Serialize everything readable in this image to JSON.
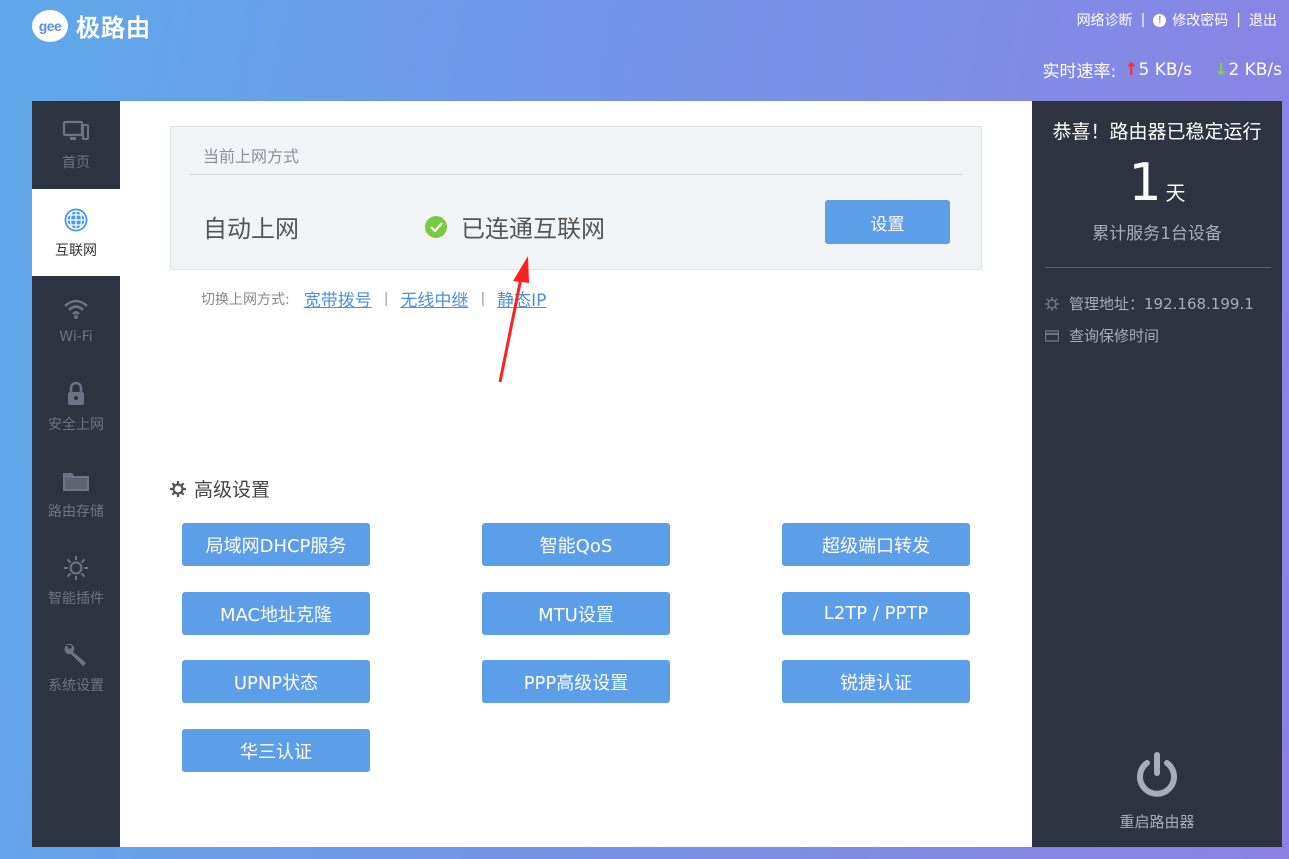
{
  "header": {
    "logo_badge": "gee",
    "title": "极路由",
    "links": {
      "diagnose": "网络诊断",
      "change_password": "修改密码",
      "logout": "退出"
    },
    "sep": "|",
    "speed_label": "实时速率:",
    "upload": "5 KB/s",
    "download": "2 KB/s",
    "up_arrow": "↑",
    "down_arrow": "↓",
    "info_icon_text": "!"
  },
  "sidebar": {
    "items": [
      {
        "label": "首页",
        "icon": "monitor-icon"
      },
      {
        "label": "互联网",
        "icon": "globe-icon",
        "active": true
      },
      {
        "label": "Wi-Fi",
        "icon": "wifi-icon"
      },
      {
        "label": "安全上网",
        "icon": "lock-icon"
      },
      {
        "label": "路由存储",
        "icon": "folder-icon"
      },
      {
        "label": "智能插件",
        "icon": "bulb-icon"
      },
      {
        "label": "系统设置",
        "icon": "wrench-icon"
      }
    ]
  },
  "main": {
    "card": {
      "title": "当前上网方式",
      "mode": "自动上网",
      "status": "已连通互联网",
      "set_button": "设置"
    },
    "switch": {
      "label": "切换上网方式:",
      "options": [
        "宽带拨号",
        "无线中继",
        "静态IP"
      ],
      "sep": "|"
    },
    "advanced": {
      "title": "高级设置",
      "buttons": [
        "局域网DHCP服务",
        "智能QoS",
        "超级端口转发",
        "MAC地址克隆",
        "MTU设置",
        "L2TP / PPTP",
        "UPNP状态",
        "PPP高级设置",
        "锐捷认证",
        "华三认证"
      ]
    }
  },
  "right": {
    "title": "恭喜！路由器已稳定运行",
    "days": "1",
    "days_unit": "天",
    "served": "累计服务1台设备",
    "admin_address": "管理地址：192.168.199.1",
    "warranty": "查询保修时间",
    "restart": "重启路由器"
  },
  "colors": {
    "accent": "#5c9ee8",
    "sidebar_bg": "#2e3340",
    "success": "#7ac943",
    "upload_arrow": "#ff2a2a",
    "download_arrow": "#7fd14a",
    "annotation_arrow": "#ff2020"
  }
}
